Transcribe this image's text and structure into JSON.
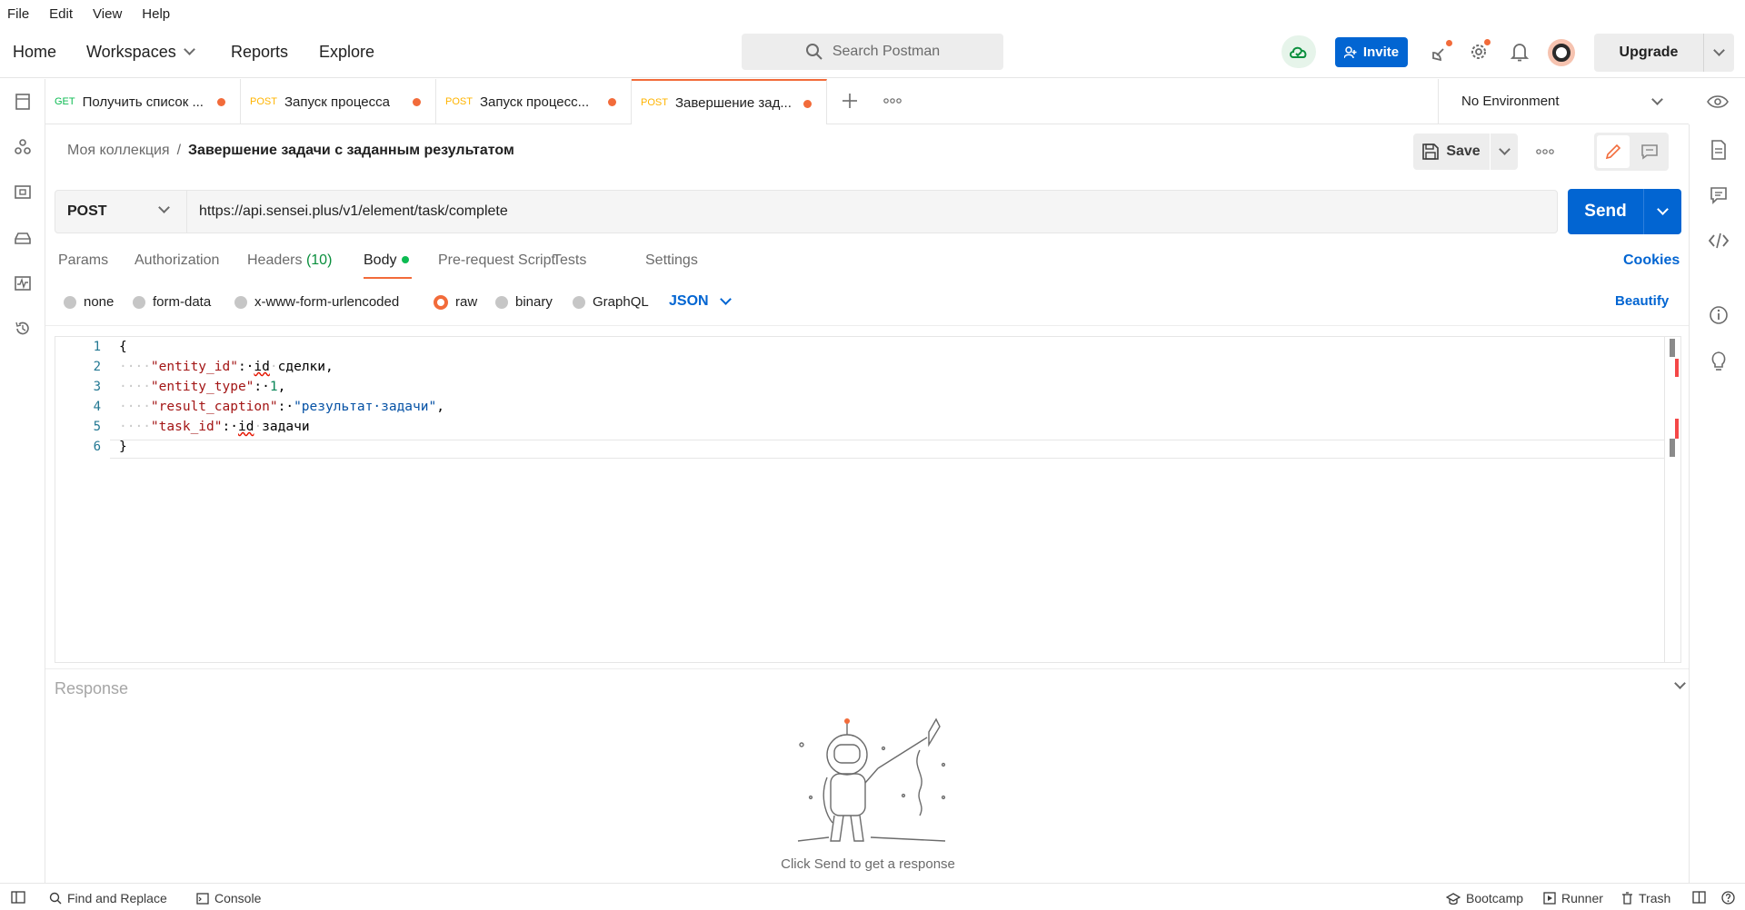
{
  "menu": [
    "File",
    "Edit",
    "View",
    "Help"
  ],
  "nav": {
    "home": "Home",
    "workspaces": "Workspaces",
    "reports": "Reports",
    "explore": "Explore"
  },
  "search": {
    "placeholder": "Search Postman"
  },
  "header": {
    "invite": "Invite",
    "upgrade": "Upgrade"
  },
  "tabs": [
    {
      "method": "GET",
      "label": "Получить список ..."
    },
    {
      "method": "POST",
      "label": "Запуск процесса"
    },
    {
      "method": "POST",
      "label": "Запуск процесс..."
    },
    {
      "method": "POST",
      "label": "Завершение зад..."
    }
  ],
  "environment": "No Environment",
  "breadcrumb": {
    "collection": "Моя коллекция",
    "separator": "/",
    "request": "Завершение задачи с заданным результатом"
  },
  "actions": {
    "save": "Save"
  },
  "request": {
    "method": "POST",
    "url": "https://api.sensei.plus/v1/element/task/complete",
    "send": "Send"
  },
  "request_tabs": {
    "params": "Params",
    "authorization": "Authorization",
    "headers": "Headers",
    "headers_count": "(10)",
    "body": "Body",
    "prerequest": "Pre-request Script",
    "tests": "Tests",
    "settings": "Settings",
    "cookies": "Cookies"
  },
  "body_types": {
    "none": "none",
    "form_data": "form-data",
    "urlencoded": "x-www-form-urlencoded",
    "raw": "raw",
    "binary": "binary",
    "graphql": "GraphQL",
    "language": "JSON",
    "beautify": "Beautify",
    "selected": "raw"
  },
  "editor": {
    "line_numbers": [
      "1",
      "2",
      "3",
      "4",
      "5",
      "6"
    ],
    "open_brace": "{",
    "close_brace": "}",
    "indent": "····",
    "k_entity_id": "\"entity_id\"",
    "v_entity_id_a": "id",
    "v_entity_id_b": "сделки,",
    "k_entity_type": "\"entity_type\"",
    "v_entity_type": "1",
    "k_result_caption": "\"result_caption\"",
    "v_result_caption": "\"результат·задачи\"",
    "k_task_id": "\"task_id\"",
    "v_task_id_a": "id",
    "v_task_id_b": "задачи",
    "colon": ":·",
    "comma": ","
  },
  "response": {
    "title": "Response",
    "hint": "Click Send to get a response"
  },
  "statusbar": {
    "find_replace": "Find and Replace",
    "console": "Console",
    "bootcamp": "Bootcamp",
    "runner": "Runner",
    "trash": "Trash"
  },
  "colors": {
    "accent": "#f26b3a",
    "primary": "#0265d2",
    "get": "#0cbb52",
    "post": "#ffb400"
  }
}
